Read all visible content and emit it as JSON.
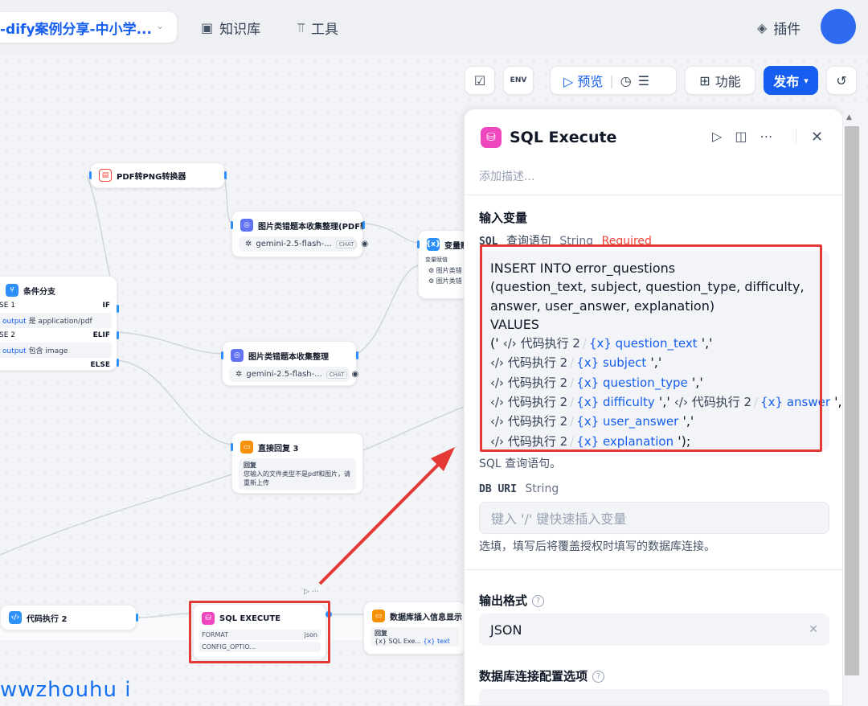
{
  "topbar": {
    "app_name": "-dify案例分享-中小学...",
    "knowledge_label": "知识库",
    "tools_label": "工具",
    "plugins_label": "插件"
  },
  "toolbar": {
    "preview_label": "预览",
    "features_label": "功能",
    "publish_label": "发布",
    "env_label": "ENV"
  },
  "canvas": {
    "nodes": {
      "pdf_to_png": {
        "title": "PDF转PNG转换器"
      },
      "img_collect_pdf": {
        "title": "图片类错题本收集整理(PDF转",
        "model": "gemini-2.5-flash-...",
        "badge": "CHAT"
      },
      "var_assign": {
        "title": "变量赋",
        "sub": "变量赋值",
        "item1": "图片类错",
        "item2": "图片类错"
      },
      "condition": {
        "title": "条件分支",
        "case1": "SE 1",
        "if_label": "IF",
        "cond1_var": "output",
        "cond1_op": "是 application/pdf",
        "case2": "SE 2",
        "elif_label": "ELIF",
        "cond2_var": "output",
        "cond2_op": "包含 image",
        "else_label": "ELSE"
      },
      "img_collect": {
        "title": "图片类错题本收集整理",
        "model": "gemini-2.5-flash-...",
        "badge": "CHAT"
      },
      "direct_reply": {
        "title": "直接回复 3",
        "label": "回复",
        "text": "您输入的文件类型不是pdf和图片，请重新上传"
      },
      "code_exec": {
        "title": "代码执行 2"
      },
      "sql_execute": {
        "title": "SQL EXECUTE",
        "format_label": "FORMAT",
        "format_value": "json",
        "config_label": "CONFIG_OPTIO..."
      },
      "db_insert": {
        "title": "数据库插入信息显示",
        "label": "回复",
        "ref_node": "SQL Exe...",
        "ref_var": "text"
      }
    }
  },
  "panel": {
    "title": "SQL Execute",
    "desc_placeholder": "添加描述...",
    "input_vars_title": "输入变量",
    "sql_field": {
      "name": "SQL",
      "label": "查询语句",
      "type": "String",
      "required": "Required"
    },
    "sql_lines": [
      "INSERT INTO error_questions",
      "(question_text, subject, question_type, difficulty,",
      "answer, user_answer, explanation)",
      "VALUES"
    ],
    "sql_refs": {
      "node": "代码执行 2",
      "v1": "question_text",
      "v2": "subject",
      "v3": "question_type",
      "v4": "difficulty",
      "v5": "answer",
      "v6": "user_answer",
      "v7": "explanation",
      "open": "('",
      "comma": "','",
      "close": "');"
    },
    "sql_hint": "SQL 查询语句。",
    "db_uri": {
      "name": "DB URI",
      "type": "String",
      "placeholder": "键入 '/' 键快速插入变量",
      "hint": "选填，填写后将覆盖授权时填写的数据库连接。"
    },
    "output_format": {
      "title": "输出格式",
      "value": "JSON"
    },
    "db_config": {
      "title": "数据库连接配置选项"
    }
  },
  "watermark": "wwzhouhu i",
  "colors": {
    "accent": "#155eef",
    "annotation": "#e53935"
  }
}
